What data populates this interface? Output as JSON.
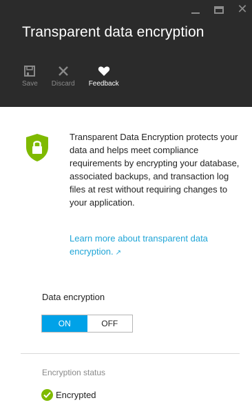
{
  "header": {
    "title": "Transparent data encryption",
    "window_controls": {
      "minimize_icon": "minimize-icon",
      "maximize_icon": "maximize-icon",
      "close_icon": "close-icon"
    },
    "toolbar": [
      {
        "label": "Save",
        "icon": "save-icon",
        "state": "disabled"
      },
      {
        "label": "Discard",
        "icon": "discard-icon",
        "state": "disabled"
      },
      {
        "label": "Feedback",
        "icon": "heart-icon",
        "state": "enabled"
      }
    ]
  },
  "main": {
    "shield_icon": "lock-shield-icon",
    "description": "Transparent Data Encryption protects your data and helps meet compliance requirements by encrypting your database, associated backups, and transaction log files at rest without requiring changes to your application.",
    "learn_more_link": "Learn more about transparent data encryption.",
    "data_encryption": {
      "label": "Data encryption",
      "options": [
        "ON",
        "OFF"
      ],
      "selected": "ON"
    },
    "encryption_status": {
      "label": "Encryption status",
      "value": "Encrypted",
      "icon": "check-circle-icon"
    }
  },
  "colors": {
    "header_bg": "#2b2b2b",
    "accent": "#00a2e8",
    "link": "#1fa5d7",
    "shield": "#7fba00",
    "success": "#7fba00"
  }
}
